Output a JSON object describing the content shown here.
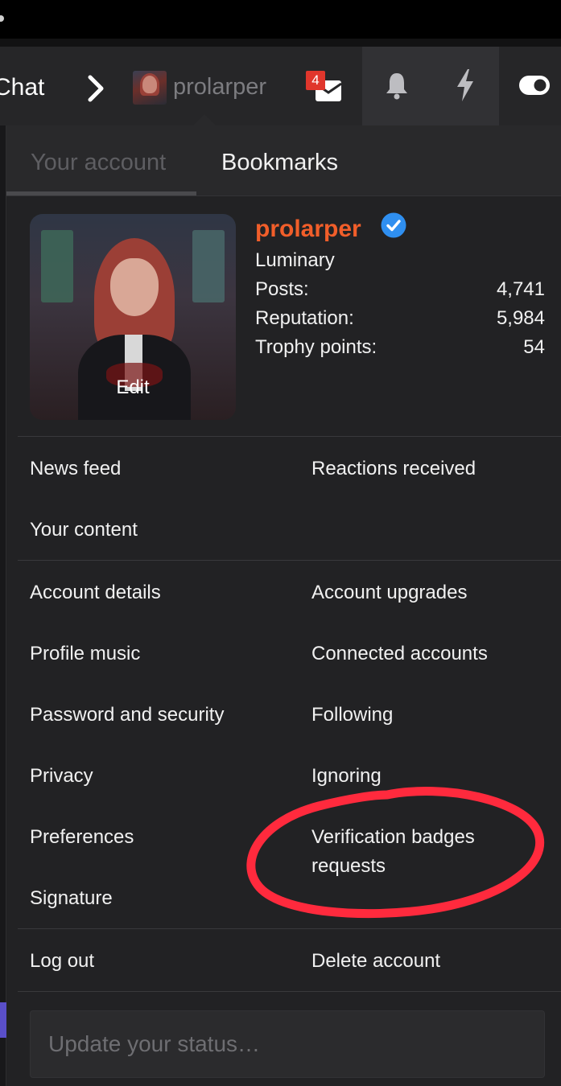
{
  "nav": {
    "section_label": "Chat",
    "username": "prolarper",
    "inbox_count": "4"
  },
  "tabs": {
    "account": "Your account",
    "bookmarks": "Bookmarks"
  },
  "profile": {
    "username": "prolarper",
    "title": "Luminary",
    "avatar_edit": "Edit",
    "stats": [
      {
        "label": "Posts:",
        "value": "4,741"
      },
      {
        "label": "Reputation:",
        "value": "5,984"
      },
      {
        "label": "Trophy points:",
        "value": "54"
      }
    ]
  },
  "menu": {
    "news_feed": "News feed",
    "reactions_received": "Reactions received",
    "your_content": "Your content",
    "account_details": "Account details",
    "account_upgrades": "Account upgrades",
    "profile_music": "Profile music",
    "connected_accounts": "Connected accounts",
    "password_security": "Password and security",
    "following": "Following",
    "privacy": "Privacy",
    "ignoring": "Ignoring",
    "preferences": "Preferences",
    "verification_1": "Verification badges",
    "verification_2": "requests",
    "signature": "Signature",
    "log_out": "Log out",
    "delete_account": "Delete account"
  },
  "status": {
    "placeholder": "Update your status…"
  },
  "colors": {
    "username": "#f15e2a",
    "verified": "#2f8ff0",
    "badge": "#e0362c",
    "annotation": "#ff2a3d"
  },
  "icons": [
    "chevron-right-icon",
    "inbox-icon",
    "bell-icon",
    "bolt-icon",
    "toggle-icon",
    "verified-icon"
  ]
}
